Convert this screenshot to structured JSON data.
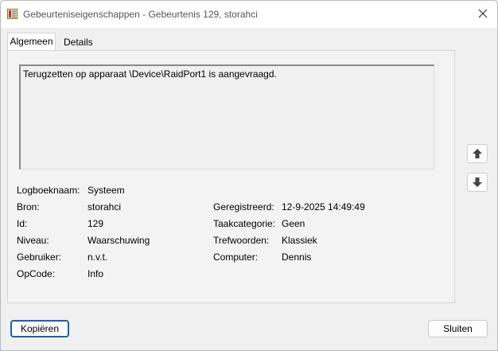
{
  "window": {
    "title": "Gebeurteniseigenschappen - Gebeurtenis 129, storahci"
  },
  "tabs": [
    {
      "label": "Algemeen",
      "active": true
    },
    {
      "label": "Details",
      "active": false
    }
  ],
  "description": "Terugzetten op apparaat \\Device\\RaidPort1 is aangevraagd.",
  "fields": {
    "logboeknaam": {
      "label": "Logboeknaam:",
      "value": "Systeem"
    },
    "bron": {
      "label": "Bron:",
      "value": "storahci"
    },
    "id": {
      "label": "Id:",
      "value": "129"
    },
    "niveau": {
      "label": "Niveau:",
      "value": "Waarschuwing"
    },
    "gebruiker": {
      "label": "Gebruiker:",
      "value": "n.v.t."
    },
    "opcode": {
      "label": "OpCode:",
      "value": "Info"
    },
    "geregistreerd": {
      "label": "Geregistreerd:",
      "value": "12-9-2025 14:49:49"
    },
    "taakcategorie": {
      "label": "Taakcategorie:",
      "value": "Geen"
    },
    "trefwoorden": {
      "label": "Trefwoorden:",
      "value": "Klassiek"
    },
    "computer": {
      "label": "Computer:",
      "value": "Dennis"
    }
  },
  "buttons": {
    "copy": "Kopiëren",
    "close": "Sluiten"
  },
  "icons": {
    "app": "event-properties-icon",
    "close": "close-icon",
    "up": "arrow-up-icon",
    "down": "arrow-down-icon"
  }
}
